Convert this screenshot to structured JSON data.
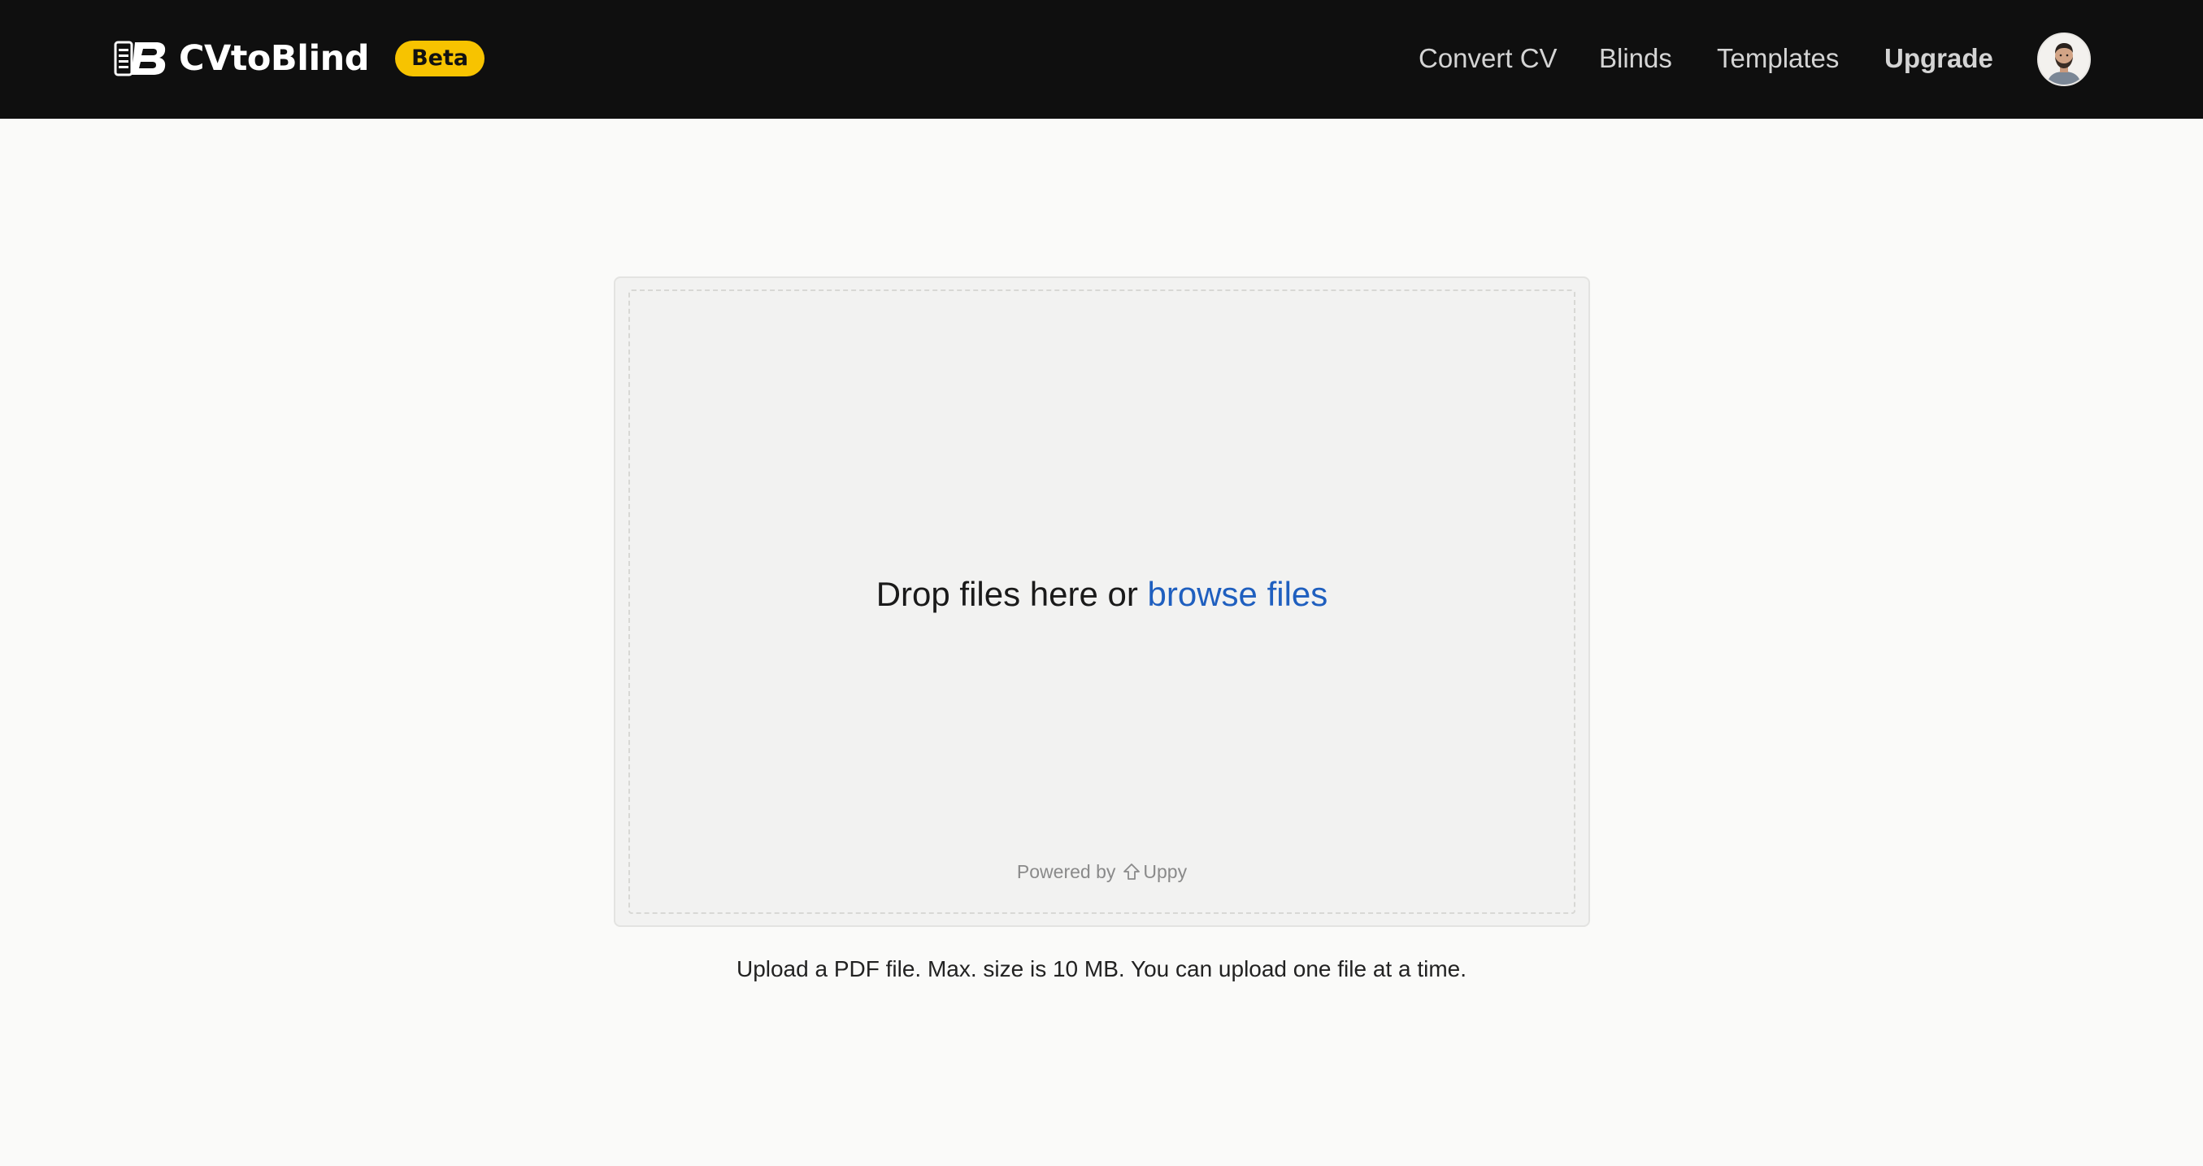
{
  "header": {
    "brand_name": "CVtoBlind",
    "beta_label": "Beta",
    "nav": {
      "convert_cv": "Convert CV",
      "blinds": "Blinds",
      "templates": "Templates",
      "upgrade": "Upgrade"
    },
    "bg_color": "#0f0f0f",
    "beta_color": "#f7c300"
  },
  "uploader": {
    "drop_text": "Drop files here or",
    "browse_text": "browse files",
    "powered_by": "Powered by",
    "uppy_label": "Uppy",
    "link_color": "#1f5fbf"
  },
  "upload_note": "Upload a PDF file. Max. size is 10 MB. You can upload one file at a time.",
  "icons": {
    "logo": "document-b-logo-icon",
    "avatar": "user-avatar",
    "uppy": "uppy-arrow-icon"
  }
}
